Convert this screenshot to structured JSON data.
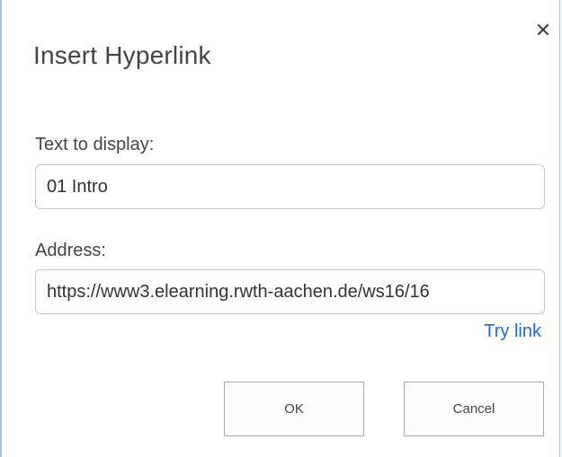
{
  "dialog": {
    "title": "Insert Hyperlink",
    "close_icon": "close-icon",
    "close_glyph": "✕"
  },
  "text_to_display": {
    "label": "Text to display:",
    "value": "01 Intro"
  },
  "address": {
    "label": "Address:",
    "value": "https://www3.elearning.rwth-aachen.de/ws16/16"
  },
  "try_link": {
    "label": "Try link"
  },
  "buttons": {
    "ok": "OK",
    "cancel": "Cancel"
  },
  "colors": {
    "link": "#1f6ad4",
    "border_accent": "#a9c4e8",
    "text": "#444444"
  }
}
